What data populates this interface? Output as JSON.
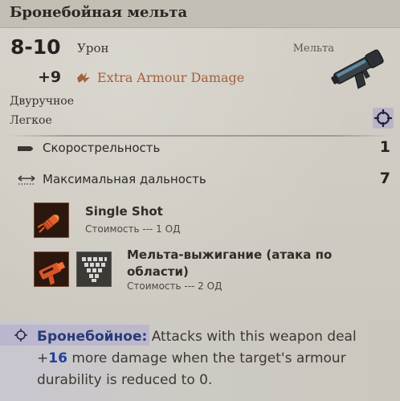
{
  "title": "Бронебойная мельта",
  "damage": {
    "range": "8-10",
    "label": "Урон"
  },
  "weapon_type": "Мельта",
  "bonus": {
    "value": "+9",
    "label": "Extra Armour Damage"
  },
  "properties": [
    "Двуручное",
    "Легкое"
  ],
  "stats": [
    {
      "label": "Скорострельность",
      "value": "1",
      "icon": "bullet-icon"
    },
    {
      "label": "Максимальная дальность",
      "value": "7",
      "icon": "range-icon"
    }
  ],
  "skills": [
    {
      "name": "Single Shot",
      "cost": "Стоимость --- 1 ОД",
      "icon": "single-shot-icon"
    },
    {
      "name_line1": "Мельта-выжигание (атака по",
      "name_line2": "области)",
      "cost": "Стоимость --- 2 ОД",
      "icon": "melta-burn-icon"
    }
  ],
  "passive": {
    "name": "Бронебойное:",
    "text_a": " Attacks with this weapon deal",
    "plus": "+",
    "number": "16",
    "text_b": " more damage when the target's armour",
    "text_c": "durability is reduced to 0."
  },
  "colors": {
    "accent_bonus": "#a4613a",
    "passive_name": "#283a78",
    "passive_number": "#23409b"
  }
}
